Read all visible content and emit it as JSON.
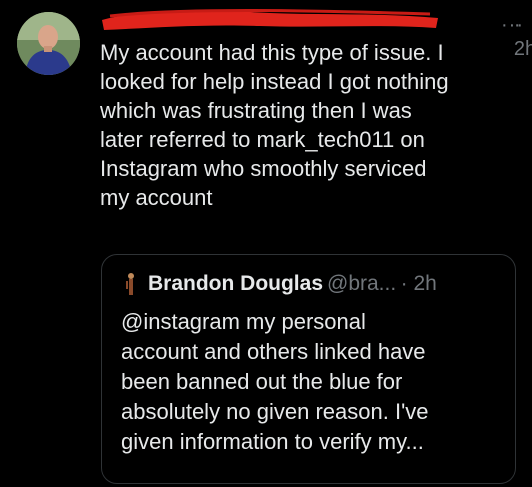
{
  "tweet": {
    "timestamp": "· 2h",
    "more_icon": "···",
    "body_lines": "My account had this type of issue. I\nlooked for help instead I got nothing\nwhich was frustrating then I was\nlater referred to mark_tech011 on\nInstagram who smoothly serviced\nmy account"
  },
  "quoted_tweet": {
    "display_name": "Brandon Douglas",
    "handle": "@bra...",
    "time": "· 2h",
    "text_lines": "@instagram my personal\naccount and others linked have\nbeen banned out the blue for\nabsolutely no given reason. I've\ngiven information to verify my..."
  },
  "colors": {
    "background": "#000000",
    "text": "#e7e9ea",
    "secondary": "#71767b",
    "border": "#2f3336",
    "redaction": "#e0241c"
  },
  "icons": {
    "more": "more-horizontal-icon",
    "avatar": "user-avatar"
  }
}
